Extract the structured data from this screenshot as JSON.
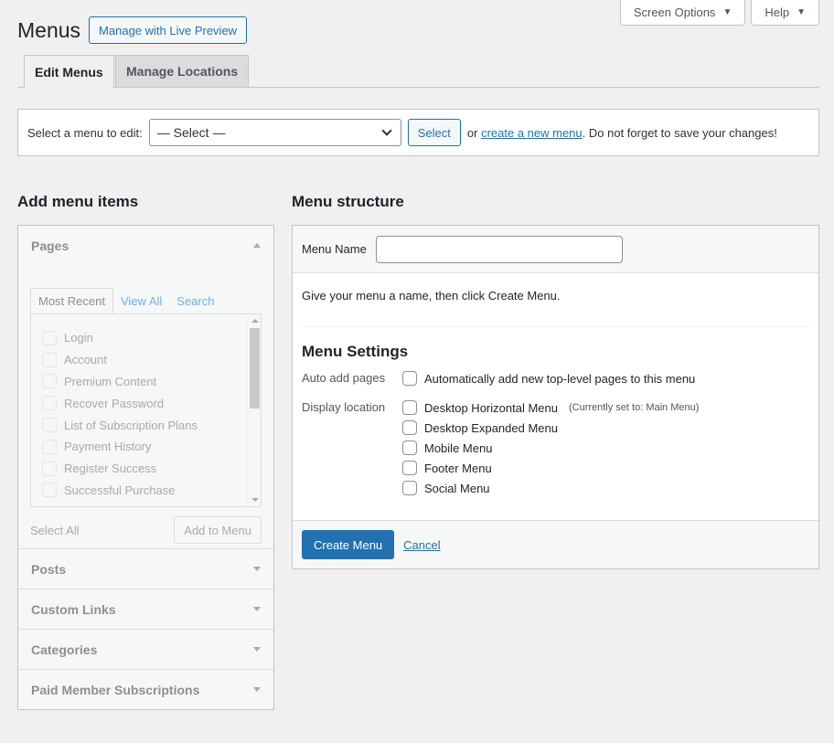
{
  "screen_meta": {
    "screen_options": "Screen Options",
    "help": "Help"
  },
  "header": {
    "title": "Menus",
    "live_preview_button": "Manage with Live Preview"
  },
  "tabs": [
    {
      "label": "Edit Menus",
      "active": true
    },
    {
      "label": "Manage Locations",
      "active": false
    }
  ],
  "manage": {
    "prompt": "Select a menu to edit:",
    "select_value": "— Select —",
    "select_button": "Select",
    "or_text": "or",
    "create_link": "create a new menu",
    "suffix": ". Do not forget to save your changes!"
  },
  "left": {
    "heading": "Add menu items",
    "sections": [
      {
        "title": "Pages",
        "expanded": true
      },
      {
        "title": "Posts"
      },
      {
        "title": "Custom Links"
      },
      {
        "title": "Categories"
      },
      {
        "title": "Paid Member Subscriptions"
      }
    ],
    "pages_tabs": [
      "Most Recent",
      "View All",
      "Search"
    ],
    "pages": [
      "Login",
      "Account",
      "Premium Content",
      "Recover Password",
      "List of Subscription Plans",
      "Payment History",
      "Register Success",
      "Successful Purchase"
    ],
    "select_all": "Select All",
    "add_button": "Add to Menu"
  },
  "right": {
    "heading": "Menu structure",
    "name_label": "Menu Name",
    "name_value": "",
    "hint": "Give your menu a name, then click Create Menu.",
    "settings_title": "Menu Settings",
    "auto_add_label": "Auto add pages",
    "auto_add_option": "Automatically add new top-level pages to this menu",
    "display_label": "Display location",
    "locations": [
      {
        "label": "Desktop Horizontal Menu",
        "note": "(Currently set to: Main Menu)"
      },
      {
        "label": "Desktop Expanded Menu",
        "note": ""
      },
      {
        "label": "Mobile Menu",
        "note": ""
      },
      {
        "label": "Footer Menu",
        "note": ""
      },
      {
        "label": "Social Menu",
        "note": ""
      }
    ],
    "create_button": "Create Menu",
    "cancel_link": "Cancel"
  },
  "colors": {
    "accent": "#2271b1",
    "background": "#f0f0f1"
  }
}
